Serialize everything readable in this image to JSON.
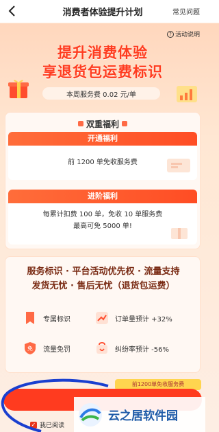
{
  "header": {
    "title": "消费者体验提升计划",
    "faq": "常见问题"
  },
  "hero": {
    "rule_link": "活动说明",
    "line1": "提升消费体验",
    "line2": "享退货包运费标识",
    "fee_text": "本周服务费 0.02 元/单"
  },
  "benefits": {
    "title": "双重福利",
    "basic": {
      "label": "开通福利",
      "text": "前 1200 单免收服务费"
    },
    "advanced": {
      "label": "进阶福利",
      "text1": "每累计扣费 100 单，免收 10 单服务费",
      "text2": "最高可免 5000 单!"
    }
  },
  "features": {
    "headline1": "服务标识 · 平台活动优先权 · 流量支持",
    "headline2": "发货无忧 · 售后无忧（退货包运费）",
    "items": [
      {
        "label": "专属标识",
        "icon": "badge-icon"
      },
      {
        "label": "订单量预计 +32%",
        "icon": "trend-up-icon"
      },
      {
        "label": "流量免罚",
        "icon": "free-shield-icon"
      },
      {
        "label": "纠纷率预计 -56%",
        "icon": "dispute-icon"
      }
    ]
  },
  "footer": {
    "tooltip": "前1200单免收服务费",
    "agree_text": "我已阅读",
    "watermark": "云之居软件园"
  },
  "colors": {
    "accent": "#ff3b1f",
    "brand_orange": "#ff6d3a",
    "watermark_blue": "#1e5aa8"
  }
}
